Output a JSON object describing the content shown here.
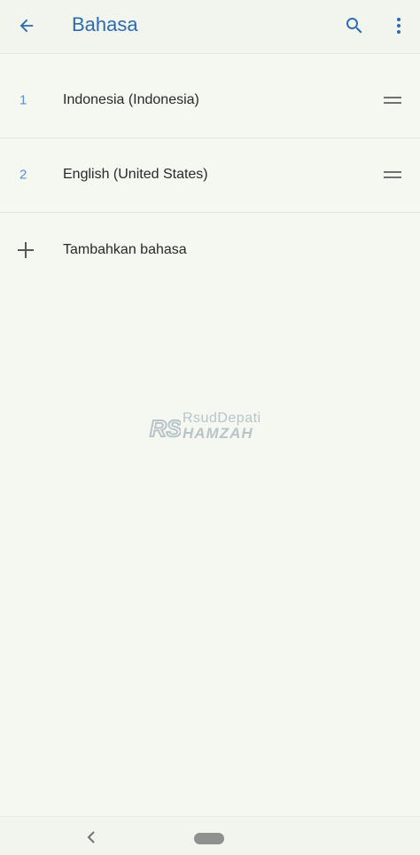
{
  "appbar": {
    "title": "Bahasa",
    "back_icon": "arrow-back-icon",
    "search_icon": "search-icon",
    "more_icon": "more-vert-icon",
    "accent_color": "#2d6bb0"
  },
  "languages": [
    {
      "index": "1",
      "label": "Indonesia (Indonesia)",
      "drag_icon": "drag-handle-icon"
    },
    {
      "index": "2",
      "label": "English (United States)",
      "drag_icon": "drag-handle-icon"
    }
  ],
  "add_language": {
    "label": "Tambahkan bahasa",
    "icon": "plus-icon"
  },
  "watermark": {
    "line1": "RsudDepati",
    "line2": "HAMZAH",
    "logo": "RS"
  },
  "navbar": {
    "back_icon": "nav-back-chevron-icon",
    "home_icon": "home-pill-icon"
  }
}
